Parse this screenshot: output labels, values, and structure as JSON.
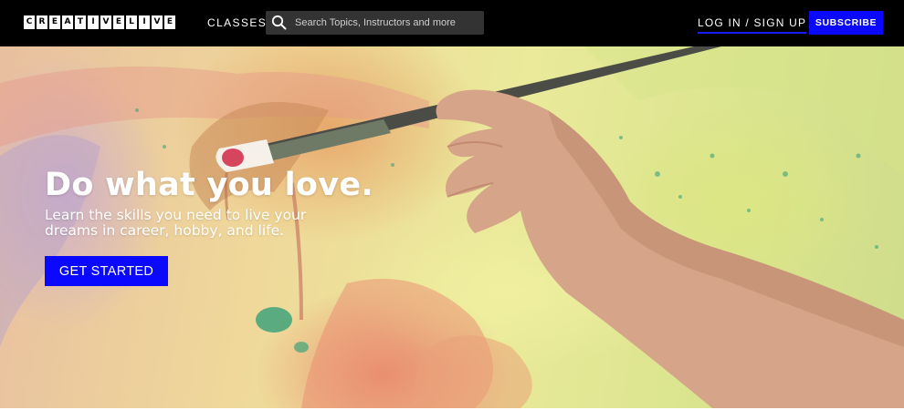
{
  "header": {
    "logo_letters": [
      "C",
      "R",
      "E",
      "A",
      "T",
      "I",
      "V",
      "E",
      "L",
      "I",
      "V",
      "E"
    ],
    "nav_classes": "CLASSES",
    "search": {
      "placeholder": "Search Topics, Instructors and more",
      "icon": "search-icon"
    },
    "login_label": "LOG IN / SIGN UP",
    "subscribe_label": "SUBSCRIBE"
  },
  "hero": {
    "headline": "Do what you love.",
    "subline": "Learn the skills you need to live your dreams in career, hobby, and life.",
    "cta_label": "GET STARTED"
  },
  "colors": {
    "header_bg": "#000000",
    "accent_blue": "#0a08ff",
    "text_white": "#ffffff",
    "search_bg": "#333333"
  }
}
